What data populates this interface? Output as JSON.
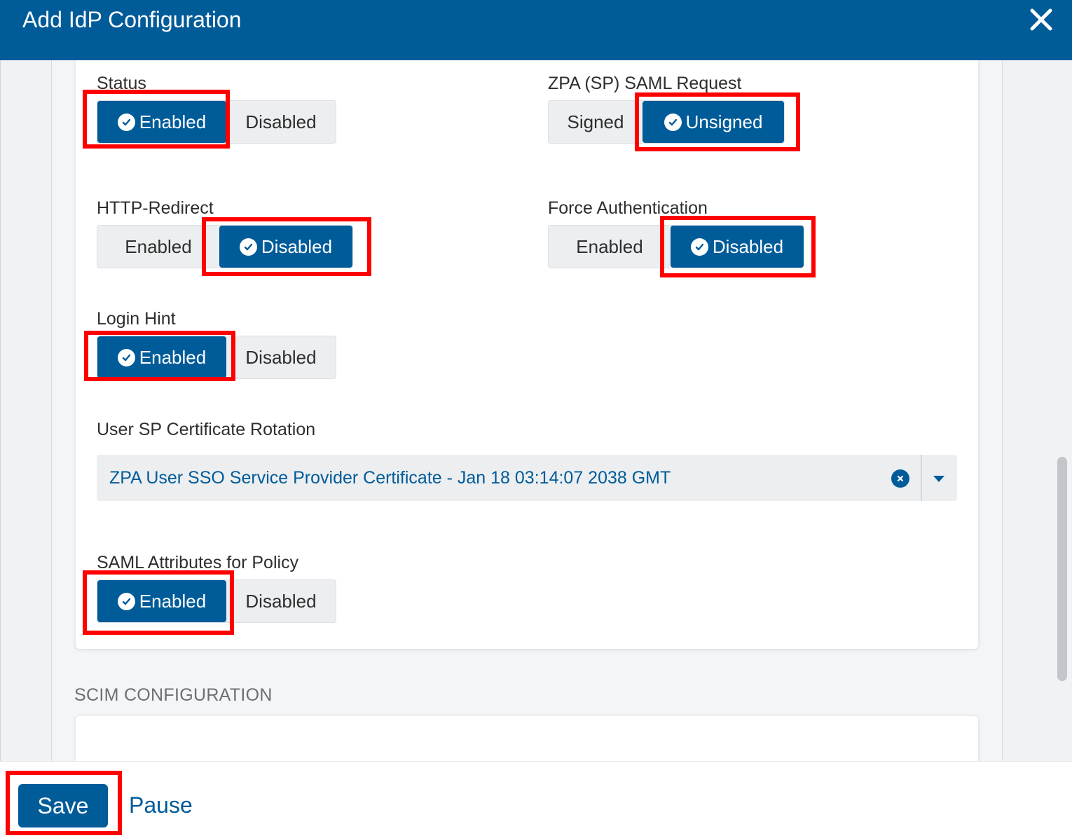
{
  "modal": {
    "title": "Add IdP Configuration",
    "close_icon": "close-icon"
  },
  "saml": {
    "status": {
      "label": "Status",
      "options": [
        "Enabled",
        "Disabled"
      ],
      "selected": "Enabled"
    },
    "sp_saml_request": {
      "label": "ZPA (SP) SAML Request",
      "options": [
        "Signed",
        "Unsigned"
      ],
      "selected": "Unsigned"
    },
    "http_redirect": {
      "label": "HTTP-Redirect",
      "options": [
        "Enabled",
        "Disabled"
      ],
      "selected": "Disabled"
    },
    "force_auth": {
      "label": "Force Authentication",
      "options": [
        "Enabled",
        "Disabled"
      ],
      "selected": "Disabled"
    },
    "login_hint": {
      "label": "Login Hint",
      "options": [
        "Enabled",
        "Disabled"
      ],
      "selected": "Enabled"
    },
    "cert_rotation": {
      "label": "User SP Certificate Rotation",
      "value": "ZPA User SSO Service Provider Certificate - Jan 18 03:14:07 2038 GMT"
    },
    "saml_attributes": {
      "label": "SAML Attributes for Policy",
      "options": [
        "Enabled",
        "Disabled"
      ],
      "selected": "Enabled"
    }
  },
  "scim": {
    "heading": "SCIM CONFIGURATION"
  },
  "footer": {
    "save_label": "Save",
    "pause_label": "Pause"
  },
  "colors": {
    "primary": "#005b99",
    "highlight": "#ff0000"
  }
}
